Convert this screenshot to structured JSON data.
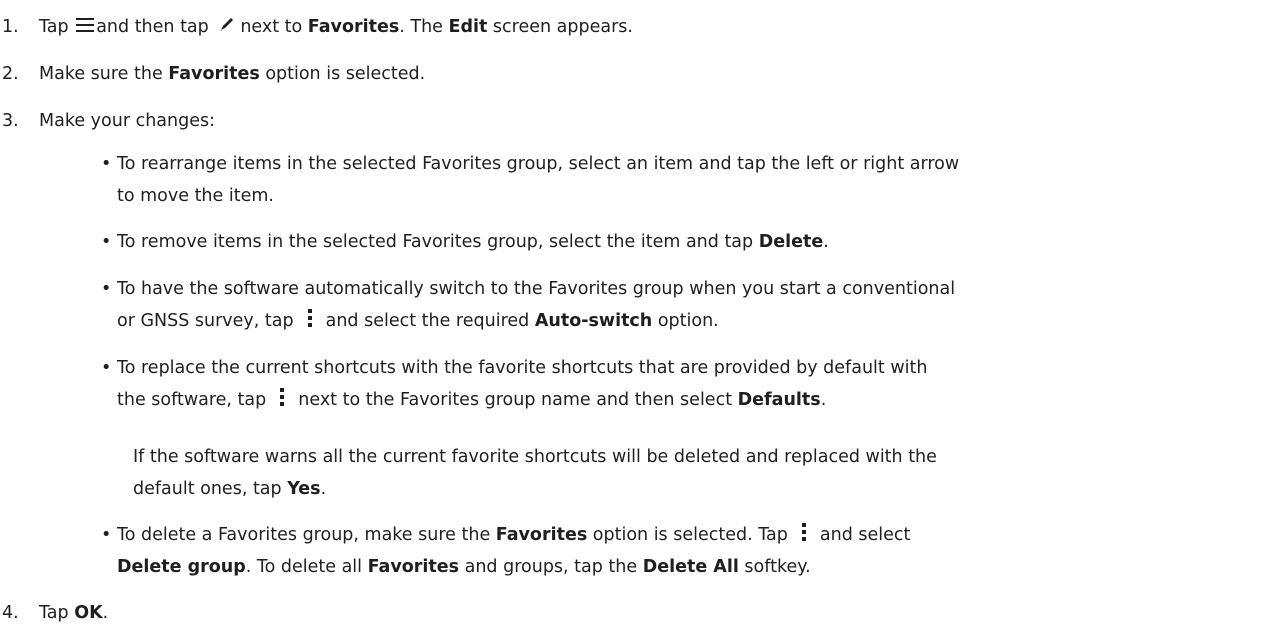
{
  "steps": [
    {
      "number": "1.",
      "t1": "Tap ",
      "t2": "and then tap ",
      "t3": "next to ",
      "b1": "Favorites",
      "t4": ". The ",
      "b2": "Edit",
      "t5": " screen appears."
    },
    {
      "number": "2.",
      "t1": "Make sure the ",
      "b1": "Favorites",
      "t2": " option is selected."
    },
    {
      "number": "3.",
      "t1": "Make your changes:"
    },
    {
      "number": "4.",
      "t1": "Tap ",
      "b1": "OK",
      "t2": "."
    }
  ],
  "bullets": [
    {
      "line1": "To rearrange items in the selected Favorites group, select an item and tap the left or right arrow",
      "line2": "to move the item."
    },
    {
      "t1": "To remove items in the selected Favorites group, select the item and tap ",
      "b1": "Delete",
      "t2": "."
    },
    {
      "line1": "To have the software automatically switch to the Favorites group when you start a conventional",
      "t1": "or GNSS survey, tap",
      "t2": "and select the required ",
      "b1": "Auto-switch",
      "t3": " option."
    },
    {
      "line1": "To replace the current shortcuts with the favorite shortcuts that are provided by default with",
      "t1": "the software, tap",
      "t2": "next to the Favorites group name and then select ",
      "b1": "Defaults",
      "t3": ".",
      "note_line1": "If the software warns all the current favorite shortcuts will be deleted and replaced with the",
      "note_t1": "default ones, tap ",
      "note_b1": "Yes",
      "note_t2": "."
    },
    {
      "t1": "To delete a Favorites group, make sure the ",
      "b1": "Favorites",
      "t2": " option is selected. Tap",
      "t3": "and select",
      "b2": "Delete group",
      "t4": ". To delete all ",
      "b3": "Favorites",
      "t5": " and groups, tap the ",
      "b4": "Delete All",
      "t6": " softkey."
    }
  ],
  "icons": {
    "menu": "hamburger-menu-icon",
    "edit": "pencil-icon",
    "more": "vertical-ellipsis-icon"
  },
  "colors": {
    "text": "#1f1f1f",
    "background": "#ffffff"
  }
}
